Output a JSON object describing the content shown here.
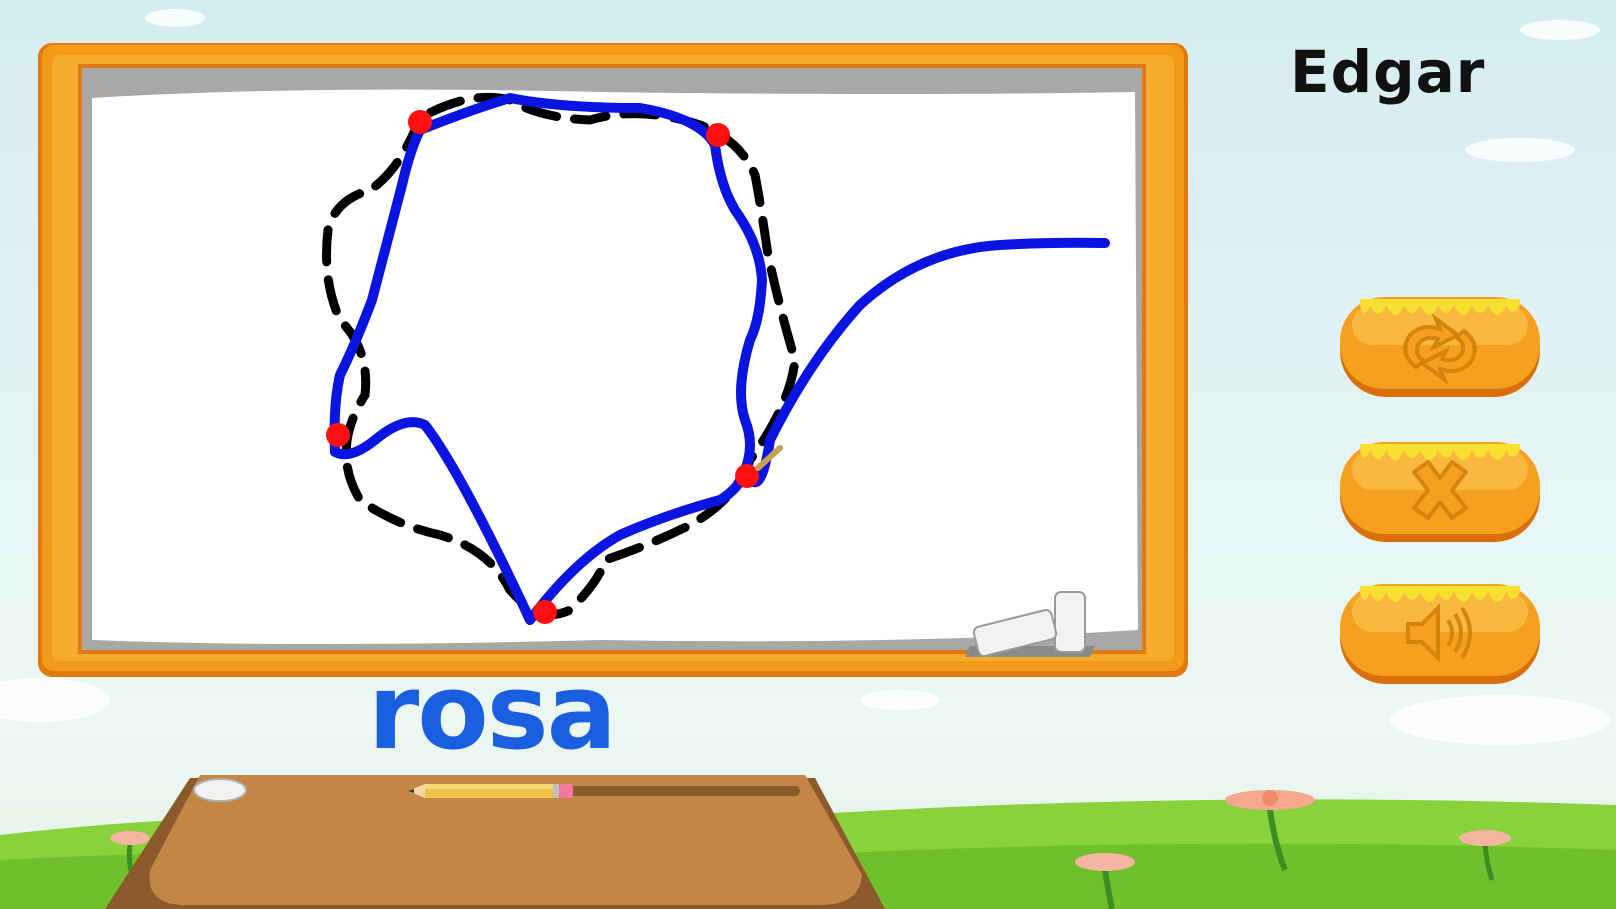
{
  "player": {
    "name": "Edgar"
  },
  "word": {
    "text": "rosa"
  },
  "colors": {
    "board_frame": "#f39a1c",
    "board_frame_dark": "#e07a0c",
    "trace_stroke": "#0a14e0",
    "guide_stroke": "#000000",
    "checkpoint": "#ff1010",
    "word": "#1a5fe0",
    "button": "#f5a020"
  },
  "buttons": [
    {
      "name": "restart-button",
      "icon": "restart-arrows-icon"
    },
    {
      "name": "clear-button",
      "icon": "close-x-icon"
    },
    {
      "name": "sound-button",
      "icon": "speaker-icon"
    }
  ]
}
